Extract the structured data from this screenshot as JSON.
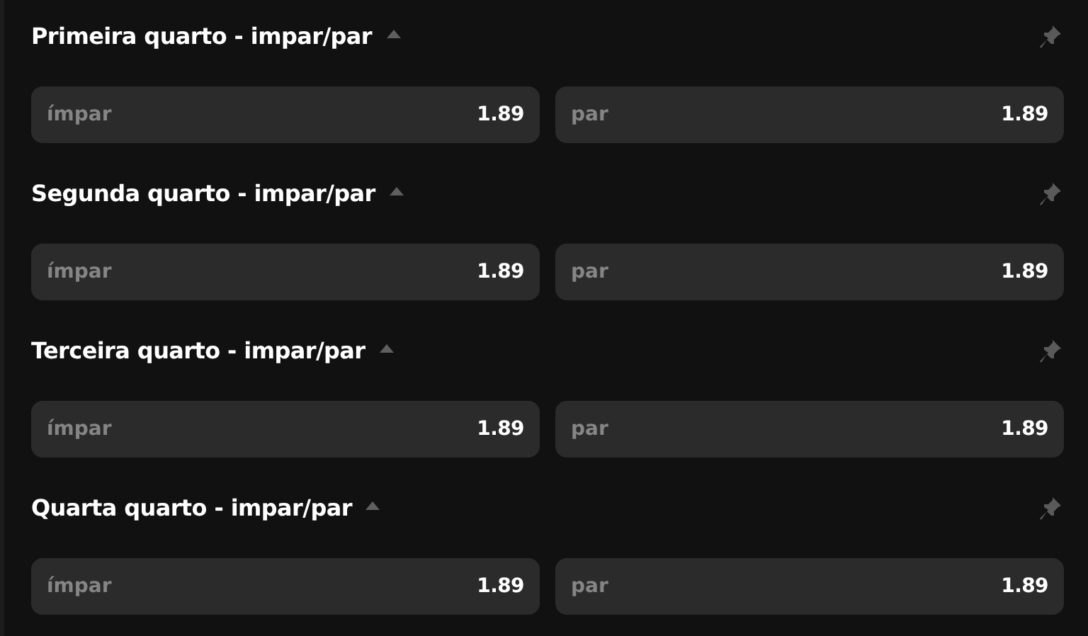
{
  "markets": [
    {
      "title": "Primeira quarto - impar/par",
      "expanded": true,
      "options": [
        {
          "label": "ímpar",
          "odds": "1.89"
        },
        {
          "label": "par",
          "odds": "1.89"
        }
      ]
    },
    {
      "title": "Segunda quarto - impar/par",
      "expanded": true,
      "options": [
        {
          "label": "ímpar",
          "odds": "1.89"
        },
        {
          "label": "par",
          "odds": "1.89"
        }
      ]
    },
    {
      "title": "Terceira quarto - impar/par",
      "expanded": true,
      "options": [
        {
          "label": "ímpar",
          "odds": "1.89"
        },
        {
          "label": "par",
          "odds": "1.89"
        }
      ]
    },
    {
      "title": "Quarta quarto - impar/par",
      "expanded": true,
      "options": [
        {
          "label": "ímpar",
          "odds": "1.89"
        },
        {
          "label": "par",
          "odds": "1.89"
        }
      ]
    }
  ]
}
